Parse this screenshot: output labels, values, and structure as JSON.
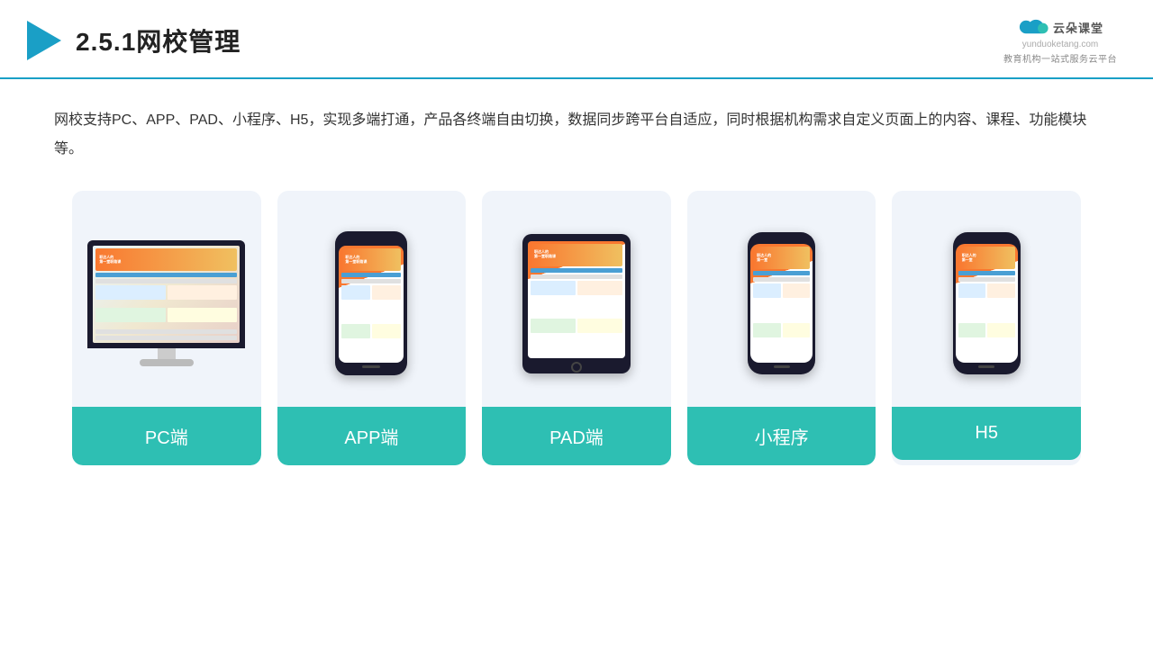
{
  "header": {
    "title": "2.5.1网校管理",
    "logo_name": "云朵课堂",
    "logo_url": "yunduoketang.com",
    "logo_tagline": "教育机构一站式服务云平台"
  },
  "description": "网校支持PC、APP、PAD、小程序、H5，实现多端打通，产品各终端自由切换，数据同步跨平台自适应，同时根据机构需求自定义页面上的内容、课程、功能模块等。",
  "cards": [
    {
      "id": "pc",
      "label": "PC端"
    },
    {
      "id": "app",
      "label": "APP端"
    },
    {
      "id": "pad",
      "label": "PAD端"
    },
    {
      "id": "miniprogram",
      "label": "小程序"
    },
    {
      "id": "h5",
      "label": "H5"
    }
  ],
  "colors": {
    "accent": "#2ebfb3",
    "border": "#1a9fc6",
    "card_bg": "#f0f4fa",
    "device_dark": "#1a1a2e",
    "orange": "#f97830"
  }
}
